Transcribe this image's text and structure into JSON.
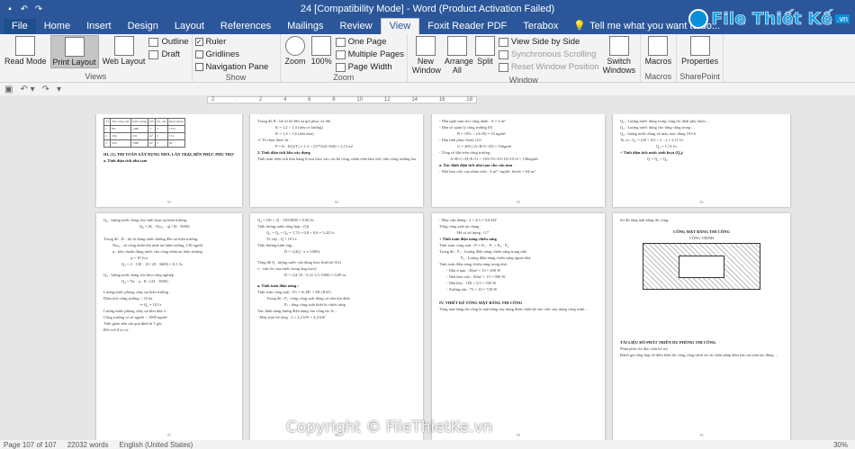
{
  "window": {
    "title": "24 [Compatibility Mode] - Word (Product Activation Failed)"
  },
  "tabs": [
    "File",
    "Home",
    "Insert",
    "Design",
    "Layout",
    "References",
    "Mailings",
    "Review",
    "View",
    "Foxit Reader PDF",
    "Terabox"
  ],
  "active_tab": "View",
  "tell_me": "Tell me what you want to do...",
  "ribbon": {
    "views": {
      "label": "Views",
      "read_mode": "Read Mode",
      "print_layout": "Print Layout",
      "web_layout": "Web Layout",
      "outline": "Outline",
      "draft": "Draft"
    },
    "show": {
      "label": "Show",
      "ruler": "Ruler",
      "gridlines": "Gridlines",
      "navigation_pane": "Navigation Pane",
      "ruler_checked": true,
      "gridlines_checked": false,
      "navigation_checked": false
    },
    "zoom": {
      "label": "Zoom",
      "zoom": "Zoom",
      "hundred": "100%",
      "one_page": "One Page",
      "multiple_pages": "Multiple Pages",
      "page_width": "Page Width"
    },
    "window": {
      "label": "Window",
      "new_window": "New Window",
      "arrange_all": "Arrange All",
      "split": "Split",
      "view_side_by_side": "View Side by Side",
      "synchronous_scrolling": "Synchronous Scrolling",
      "reset_window_position": "Reset Window Position",
      "switch_windows": "Switch Windows"
    },
    "macros": {
      "label": "Macros",
      "macros": "Macros"
    },
    "sharepoint": {
      "label": "SharePoint",
      "properties": "Properties"
    }
  },
  "logo": {
    "text": "File Thiết Kế",
    "domain": ".vn"
  },
  "watermark": "Copyright © FileThietKe.vn",
  "status": {
    "page": "Page 107 of 107",
    "words": "22032 words",
    "language": "English (United States)",
    "zoom": "30%"
  },
  "pages": {
    "p1": {
      "heading": "III. (1). THI TOÁN XÂY DỰNG NHÀ, LÁN TRẠI, BẾN PHỤC PHỤ TRỢ CÔNG TRƯỜNG",
      "sub": "a. Tính diện tích nhà tạm",
      "num": "83"
    },
    "p2": {
      "line1": "Trong đó K : hệ số kể đến sự gió phục vụ lớn",
      "line2": "K = 1,2 ÷ 1,3 (nếu có bưởng)",
      "line3": "K = 1,4 ÷ 1,6 (nếu nhỏ)",
      "line4": "⇒ Tà chọn được là :",
      "line5": "P = K . Σ(Q/T) = 1,3 × (377226/ 600) = 2,13 m³",
      "heading": "2. Tính diện tích kho xây dựng",
      "line6": "Tính toán diện tích kho hàng 6 loại theo vào các kế công, nhân viên làm việc trên công trường bao gồm :",
      "num": "84"
    },
    "p3": {
      "line1": "- Nhà nghỉ tạm cho công nhân : S = 4 m²",
      "line2": "- Dân số quản lý công trường (8)",
      "line3": "B = 10% × (A+B) = 10 người",
      "line4": "- Dân tính phục thuốc (G)",
      "line5": "G = 20% (A+B+C+D) = 10người",
      "line6": "- Tổng số dân trên công trường :",
      "line7": "A+B+C+D+E+G = 130+55+10+10+10+4 = 140người",
      "heading": "a. Xác định diện tích nhà tạm cho văn mm",
      "line8": "- Nhà làm việc của nhân viên : 4 m² / người, Snvlv = 64 m²",
      "num": "85"
    },
    "p4": {
      "line1": "Q₂ : Lượng nước dùng trong công tác nhất phụ thuộc ...",
      "line2": "Q₁ : Lượng nước dùng cho từng cũng trong ...",
      "line3": "Q₃ : lượng nước dùng về máy móc dùng 18 l/h",
      "line4": "Ta có : Q₁ = (28 × 0,9 × 2 ...) = 2,11 l/s",
      "line5": "Q₂ = 1,74 l/s",
      "heading": "+ Tính diện tích nước sinh hoạt (Q₃):",
      "line6": "Q = Q₁ + Q₂",
      "num": "86"
    },
    "p5": {
      "line1": "Q₃ : lượng nước dùng cho sinh hoạt tại hiện trường.",
      "line2": "Trong đó : K : hệ số dùng nước không đều tại hiện trường.",
      "line3": "Nₘₐₓ : số công nhân lớn nhất tại hiện trường, 130 người",
      "line4": "q : tiêu chuẩn dùng nước cho công nhân tại hiện trường",
      "line5": "Q₃ : lượng nước dùng cho khu công nghiệp",
      "line6": "Lượng nước phòng cháy tại hiện trường :",
      "line7": "Diện tích công trường < 25 ha",
      "line8": "⇒ Q₄ = 10 l/s",
      "line9": "Lượng nước phòng cháy tại khu nhà ở :",
      "line10": "Công trường có số người < 1000 người",
      "line11": "Tính giám nên tưa quá định là 3 gốc",
      "line12": "Đối với đ in có :",
      "num": "87"
    },
    "p6": {
      "line1": "Q₃ = (30 × 3) · 130/3600 = 0,56 l/s",
      "line2": "Tính lượng nước tổng hợp : (Q)",
      "line3": "Q₁ + Q₂ + Q₃ = 1,74 + 0,8 + 0,6 = 3,42 l/s",
      "line4": "Vì vậy : Q = 10 l/s",
      "line5": "Tính đường kính ống :",
      "line6": "Tổng để Q : lượng nước cần dùng theo thiết kế (l/s)",
      "line7": "v : vận tốc của nước trong ống (m/s)",
      "heading": "a. Tính toán điện năng :",
      "line8": "Tính toán công suất : Pₜₜ = K.ΣPₗ = ΣPₗ (KW)",
      "line9": "Trong đó : Pₐ : tổng công suất động cơ tiêu thụ điện",
      "line10": "Pₛ : tổng công suất thiết bị chiếu sáng",
      "line11": "Xác định năng lượng điện năng cho công tác Sₜ :",
      "line12": "- Máy trộn bê tông : 2 × 2,2 kW = 4,4 kW",
      "num": "88"
    },
    "p7": {
      "line1": "- Máy vận thăng : 2 × 4,5 = 9,0 kW",
      "line2": "Tổng công suất tác dụng :",
      "line3": "Hệ số sử dụng : 0,7",
      "heading": "+ Tính toán điện năng chiếu sáng",
      "line4": "Tính toán công suất : Pₗ = K₁ · P₁ + K₂ · P₂",
      "line5": "Trong đó : P₁ : Lượng điện năng chiếu sáng trong nhà",
      "line6": "P₂ : Lượng điện năng chiếu sáng ngoài nhà",
      "line7": "Tính toán điện năng chiếu sáng trong nhà :",
      "line8": "- Nhà ở tạm : 30m² × 15 = 450 W",
      "line9": "- Nhà làm việc : 60m² × 15 = 900 W",
      "line10": "- Nhà kho : 100 × 5,5 = 550 W",
      "line11": "- Xưởng sản : 72 × 10 = 720 W",
      "heading2": "IV. THIẾT KẾ TỔNG MẶT BẰNG THI CÔNG",
      "line12": "Tổng mặt bằng thi công là mặt bằng xây dựng được thiết kế cho việc xây dựng công trình ...",
      "num": "89"
    },
    "p8": {
      "line1": "Sơ đồ tổng mặt bằng thi công :",
      "diagram_title": "CÔNG MẶT BẰNG THI CÔNG",
      "diagram_sub": "CÔNG TRÌNH",
      "heading": "TÀI LIỆU ĐỒ PHÁT TRIỂN DỰ PHÒNG THI CÔNG",
      "line2": "Phân phối chỉ đạo chất bổ trợ",
      "line3": "Đánh giá tổng hợp về điều kiện thi công công trình và các biện pháp đảm bảo an toàn lao động ...",
      "num": "90"
    }
  }
}
